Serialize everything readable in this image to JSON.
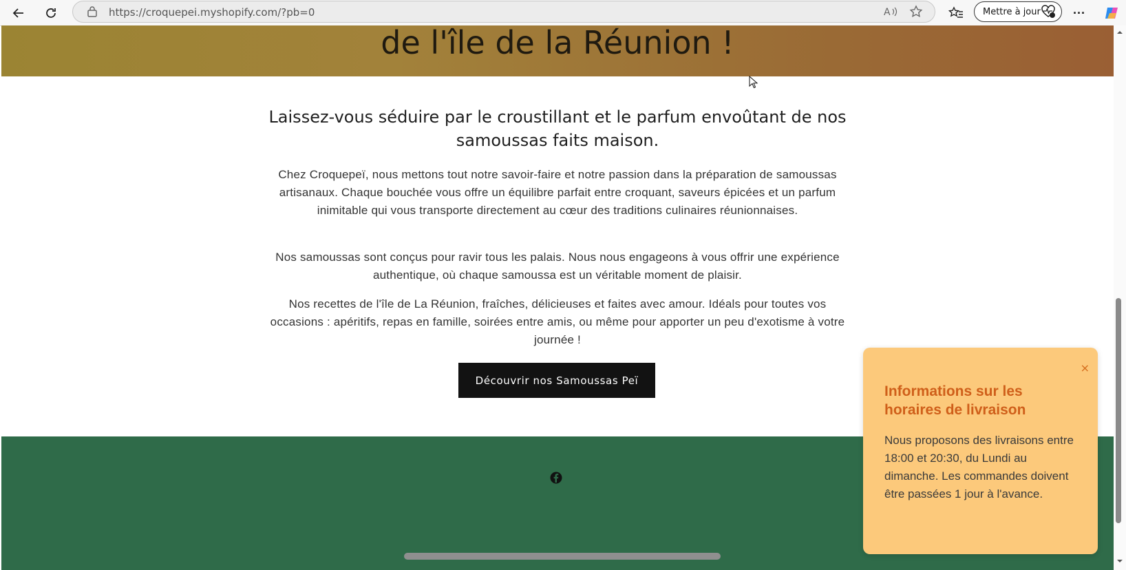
{
  "browser": {
    "url": "https://croquepei.myshopify.com/?pb=0",
    "update_button_label": "Mettre à jour",
    "more_label": "···"
  },
  "hero": {
    "title": "de l'île de la Réunion !"
  },
  "main": {
    "headline": "Laissez-vous séduire par le croustillant et le parfum envoûtant de nos samoussas faits maison.",
    "paragraphs": [
      "Chez Croquepeï, nous mettons tout notre savoir-faire et notre passion dans la préparation de samoussas artisanaux. Chaque bouchée vous offre un équilibre parfait entre croquant, saveurs épicées et un parfum inimitable qui vous transporte directement au cœur des traditions culinaires réunionnaises.",
      "Nos samoussas sont conçus pour ravir tous les palais. Nous nous engageons à vous offrir une expérience authentique, où chaque samoussa est un véritable moment de plaisir.",
      "Nos recettes de l'île de La Réunion, fraîches, délicieuses et faites avec amour. Idéals pour toutes vos occasions : apéritifs, repas en famille, soirées entre amis, ou même pour apporter un peu d'exotisme à votre journée !"
    ],
    "cta_label": "Découvrir nos Samoussas Peï"
  },
  "popup": {
    "close_label": "×",
    "title": "Informations sur les horaires de livraison",
    "body": "Nous proposons des livraisons entre 18:00 et 20:30, du Lundi au dimanche. Les commandes doivent être passées 1 jour à l'avance."
  },
  "colors": {
    "footer": "#2f6b49",
    "popup_bg": "#fcc97b",
    "popup_title": "#cf5f1a",
    "cta_bg": "#121212"
  }
}
